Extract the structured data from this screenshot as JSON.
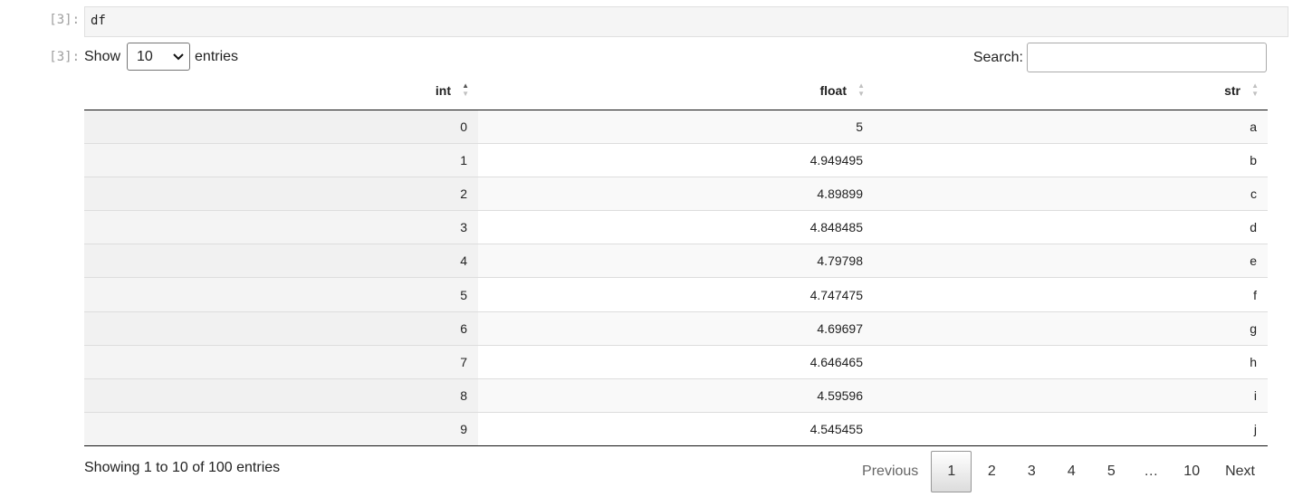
{
  "input_cell": {
    "prompt": "[3]:",
    "code": "df"
  },
  "output_cell": {
    "prompt": "[3]:"
  },
  "length_menu": {
    "prefix": "Show",
    "selected": "10",
    "suffix": "entries"
  },
  "search": {
    "label": "Search:",
    "value": ""
  },
  "table": {
    "columns": [
      "int",
      "float",
      "str"
    ],
    "sorted_column": "int",
    "sort_direction": "ascending",
    "rows": [
      [
        "0",
        "5",
        "a"
      ],
      [
        "1",
        "4.949495",
        "b"
      ],
      [
        "2",
        "4.89899",
        "c"
      ],
      [
        "3",
        "4.848485",
        "d"
      ],
      [
        "4",
        "4.79798",
        "e"
      ],
      [
        "5",
        "4.747475",
        "f"
      ],
      [
        "6",
        "4.69697",
        "g"
      ],
      [
        "7",
        "4.646465",
        "h"
      ],
      [
        "8",
        "4.59596",
        "i"
      ],
      [
        "9",
        "4.545455",
        "j"
      ]
    ]
  },
  "info": "Showing 1 to 10 of 100 entries",
  "pagination": {
    "previous": "Previous",
    "pages": [
      "1",
      "2",
      "3",
      "4",
      "5",
      "…",
      "10"
    ],
    "current": "1",
    "next": "Next"
  }
}
